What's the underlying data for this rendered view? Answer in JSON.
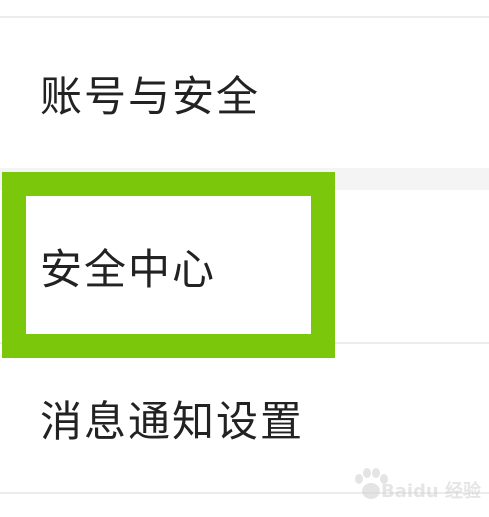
{
  "menu": {
    "items": [
      {
        "label": "账号与安全"
      },
      {
        "label": "安全中心"
      },
      {
        "label": "消息通知设置"
      }
    ]
  },
  "highlight": {
    "color": "#7ac70c"
  },
  "watermark": {
    "text": "Baidu 经验"
  }
}
